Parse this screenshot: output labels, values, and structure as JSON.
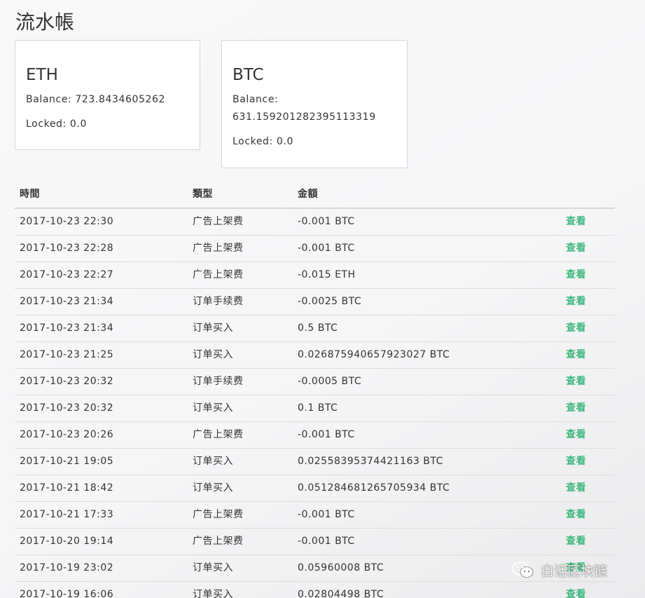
{
  "page": {
    "title": "流水帳"
  },
  "wallets": {
    "eth": {
      "name": "ETH",
      "balance_label": "Balance:",
      "balance": "723.8434605262",
      "locked_label": "Locked:",
      "locked": "0.0"
    },
    "btc": {
      "name": "BTC",
      "balance_label": "Balance:",
      "balance": "631.159201282395113319",
      "locked_label": "Locked:",
      "locked": "0.0"
    }
  },
  "ledger": {
    "headers": {
      "time": "時間",
      "type": "類型",
      "amount": "金額"
    },
    "action_label": "查看",
    "rows": [
      {
        "time": "2017-10-23 22:30",
        "type": "广告上架费",
        "amount": "-0.001 BTC"
      },
      {
        "time": "2017-10-23 22:28",
        "type": "广告上架费",
        "amount": "-0.001 BTC"
      },
      {
        "time": "2017-10-23 22:27",
        "type": "广告上架费",
        "amount": "-0.015 ETH"
      },
      {
        "time": "2017-10-23 21:34",
        "type": "订单手续费",
        "amount": "-0.0025 BTC"
      },
      {
        "time": "2017-10-23 21:34",
        "type": "订单买入",
        "amount": "0.5 BTC"
      },
      {
        "time": "2017-10-23 21:25",
        "type": "订单买入",
        "amount": "0.026875940657923027 BTC"
      },
      {
        "time": "2017-10-23 20:32",
        "type": "订单手续费",
        "amount": "-0.0005 BTC"
      },
      {
        "time": "2017-10-23 20:32",
        "type": "订单买入",
        "amount": "0.1 BTC"
      },
      {
        "time": "2017-10-23 20:26",
        "type": "广告上架费",
        "amount": "-0.001 BTC"
      },
      {
        "time": "2017-10-21 19:05",
        "type": "订单买入",
        "amount": "0.02558395374421163 BTC"
      },
      {
        "time": "2017-10-21 18:42",
        "type": "订单买入",
        "amount": "0.051284681265705934 BTC"
      },
      {
        "time": "2017-10-21 17:33",
        "type": "广告上架费",
        "amount": "-0.001 BTC"
      },
      {
        "time": "2017-10-20 19:14",
        "type": "广告上架费",
        "amount": "-0.001 BTC"
      },
      {
        "time": "2017-10-19 23:02",
        "type": "订单买入",
        "amount": "0.05960008 BTC"
      },
      {
        "time": "2017-10-19 16:06",
        "type": "订单买入",
        "amount": "0.02804498 BTC"
      }
    ]
  },
  "watermark": {
    "text": "白话区块链",
    "icon": "wechat-icon"
  },
  "colors": {
    "action_green": "#3fb87c"
  }
}
